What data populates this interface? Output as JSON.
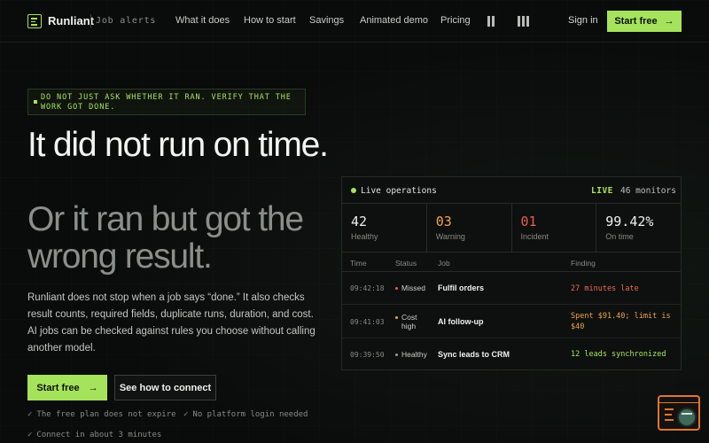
{
  "nav": {
    "brand": "Runliant",
    "brand_sub": "Job alerts",
    "links": [
      "What it does",
      "How to start",
      "Savings",
      "Animated demo",
      "Pricing"
    ],
    "signin": "Sign in",
    "start": "Start free",
    "start_arrow": "→"
  },
  "hero": {
    "kicker": "DO NOT JUST ASK WHETHER IT RAN. VERIFY THAT THE WORK GOT DONE.",
    "headline": "It did not run on time.",
    "headline_dim": "Or it ran but got the wrong result.",
    "description": "Runliant does not stop when a job says “done.” It also checks result counts, required fields, duplicate runs, duration, and cost. AI jobs can be checked against rules you choose without calling another model.",
    "cta_primary": "Start free",
    "cta_arrow": "→",
    "cta_secondary": "See how to connect",
    "check_mark": "✓",
    "checks": [
      "The free plan does not expire",
      "No platform login needed",
      "Connect in about 3 minutes"
    ]
  },
  "panel": {
    "title": "Live operations",
    "live": "LIVE",
    "monitors": "46 monitors",
    "stats": [
      {
        "value": "42",
        "label": "Healthy",
        "color": "#eef0ee"
      },
      {
        "value": "03",
        "label": "Warning",
        "color": "#f0a44a"
      },
      {
        "value": "01",
        "label": "Incident",
        "color": "#ef5a4f"
      },
      {
        "value": "99.42%",
        "label": "On time",
        "color": "#eef0ee"
      }
    ],
    "columns": [
      "Time",
      "Status",
      "Job",
      "Finding"
    ],
    "rows": [
      {
        "time": "09:42:18",
        "status": "Missed",
        "status_color": "#ef5a4f",
        "job": "Fulfil orders",
        "finding": "27 minutes late",
        "finding_color": "#ef6a5a"
      },
      {
        "time": "09:41:03",
        "status": "Cost high",
        "status_color": "#f0a44a",
        "job": "AI follow-up",
        "finding": "Spent $91.40; limit is $40",
        "finding_color": "#f0a44a"
      },
      {
        "time": "09:39:50",
        "status": "Healthy",
        "status_color": "#9aa09b",
        "job": "Sync leads to CRM",
        "finding": "12 leads synchronized",
        "finding_color": "#a6e35c"
      }
    ]
  },
  "colors": {
    "accent": "#a6e35c",
    "background": "#0a0c0b",
    "widget": "#e0762c"
  },
  "icons": [
    "menu-logo-icon",
    "pause-icon",
    "bars-icon",
    "arrow-right-icon",
    "check-icon",
    "status-dot-icon",
    "chat-widget-icon"
  ]
}
